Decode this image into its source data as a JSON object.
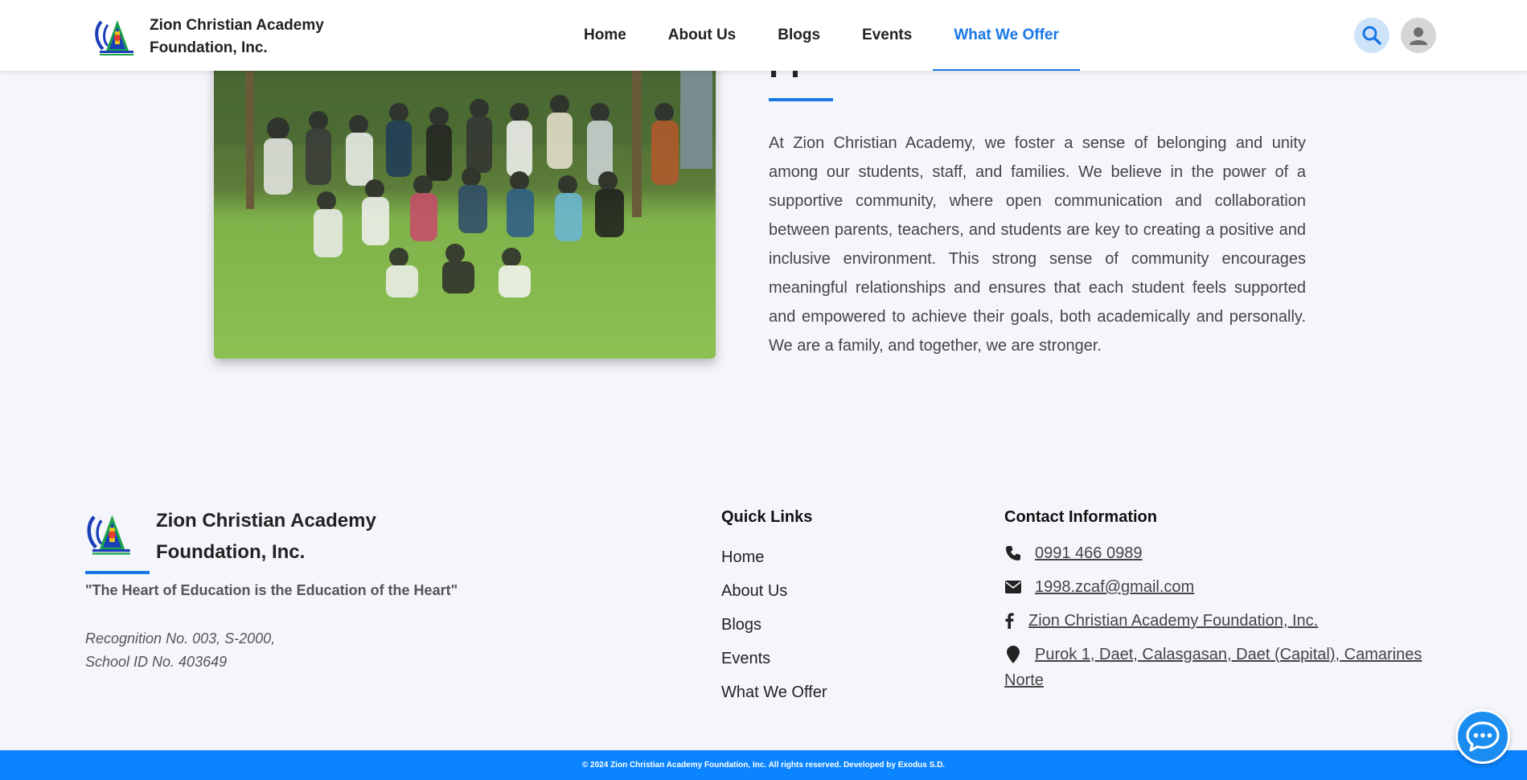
{
  "brand": {
    "name": "Zion Christian Academy Foundation, Inc.",
    "logo_icon": "school-logo"
  },
  "nav": {
    "items": [
      {
        "label": "Home",
        "active": false
      },
      {
        "label": "About Us",
        "active": false
      },
      {
        "label": "Blogs",
        "active": false
      },
      {
        "label": "Events",
        "active": false
      },
      {
        "label": "What We Offer",
        "active": true
      }
    ],
    "search_icon": "search-icon",
    "user_icon": "user-icon"
  },
  "section": {
    "heading_fragment": "pp",
    "body": "At Zion Christian Academy, we foster a sense of belonging and unity among our students, staff, and families. We believe in the power of a supportive community, where open communication and collaboration between parents, teachers, and students are key to creating a positive and inclusive environment. This strong sense of community encourages meaningful relationships and ensures that each student feels supported and empowered to achieve their goals, both academically and personally. We are a family, and together, we are stronger."
  },
  "footer": {
    "brand_name": "Zion Christian Academy Foundation, Inc.",
    "tagline": "\"The Heart of Education is the Education of the Heart\"",
    "recognition": "Recognition No. 003, S-2000,",
    "school_id": "School ID No. 403649",
    "quick_links": {
      "title": "Quick Links",
      "items": [
        "Home",
        "About Us",
        "Blogs",
        "Events",
        "What We Offer"
      ]
    },
    "contact": {
      "title": "Contact Information",
      "phone": "0991 466 0989",
      "email": "1998.zcaf@gmail.com",
      "facebook": "Zion Christian Academy Foundation, Inc.",
      "address": "Purok 1, Daet, Calasgasan, Daet (Capital), Camarines Norte"
    },
    "copyright": "© 2024 Zion Christian Academy Foundation, Inc. All rights reserved. Developed by Exodus S.D."
  },
  "colors": {
    "accent": "#1877e6",
    "bottom_bar": "#0b84ff",
    "background": "#f5f6fb"
  }
}
